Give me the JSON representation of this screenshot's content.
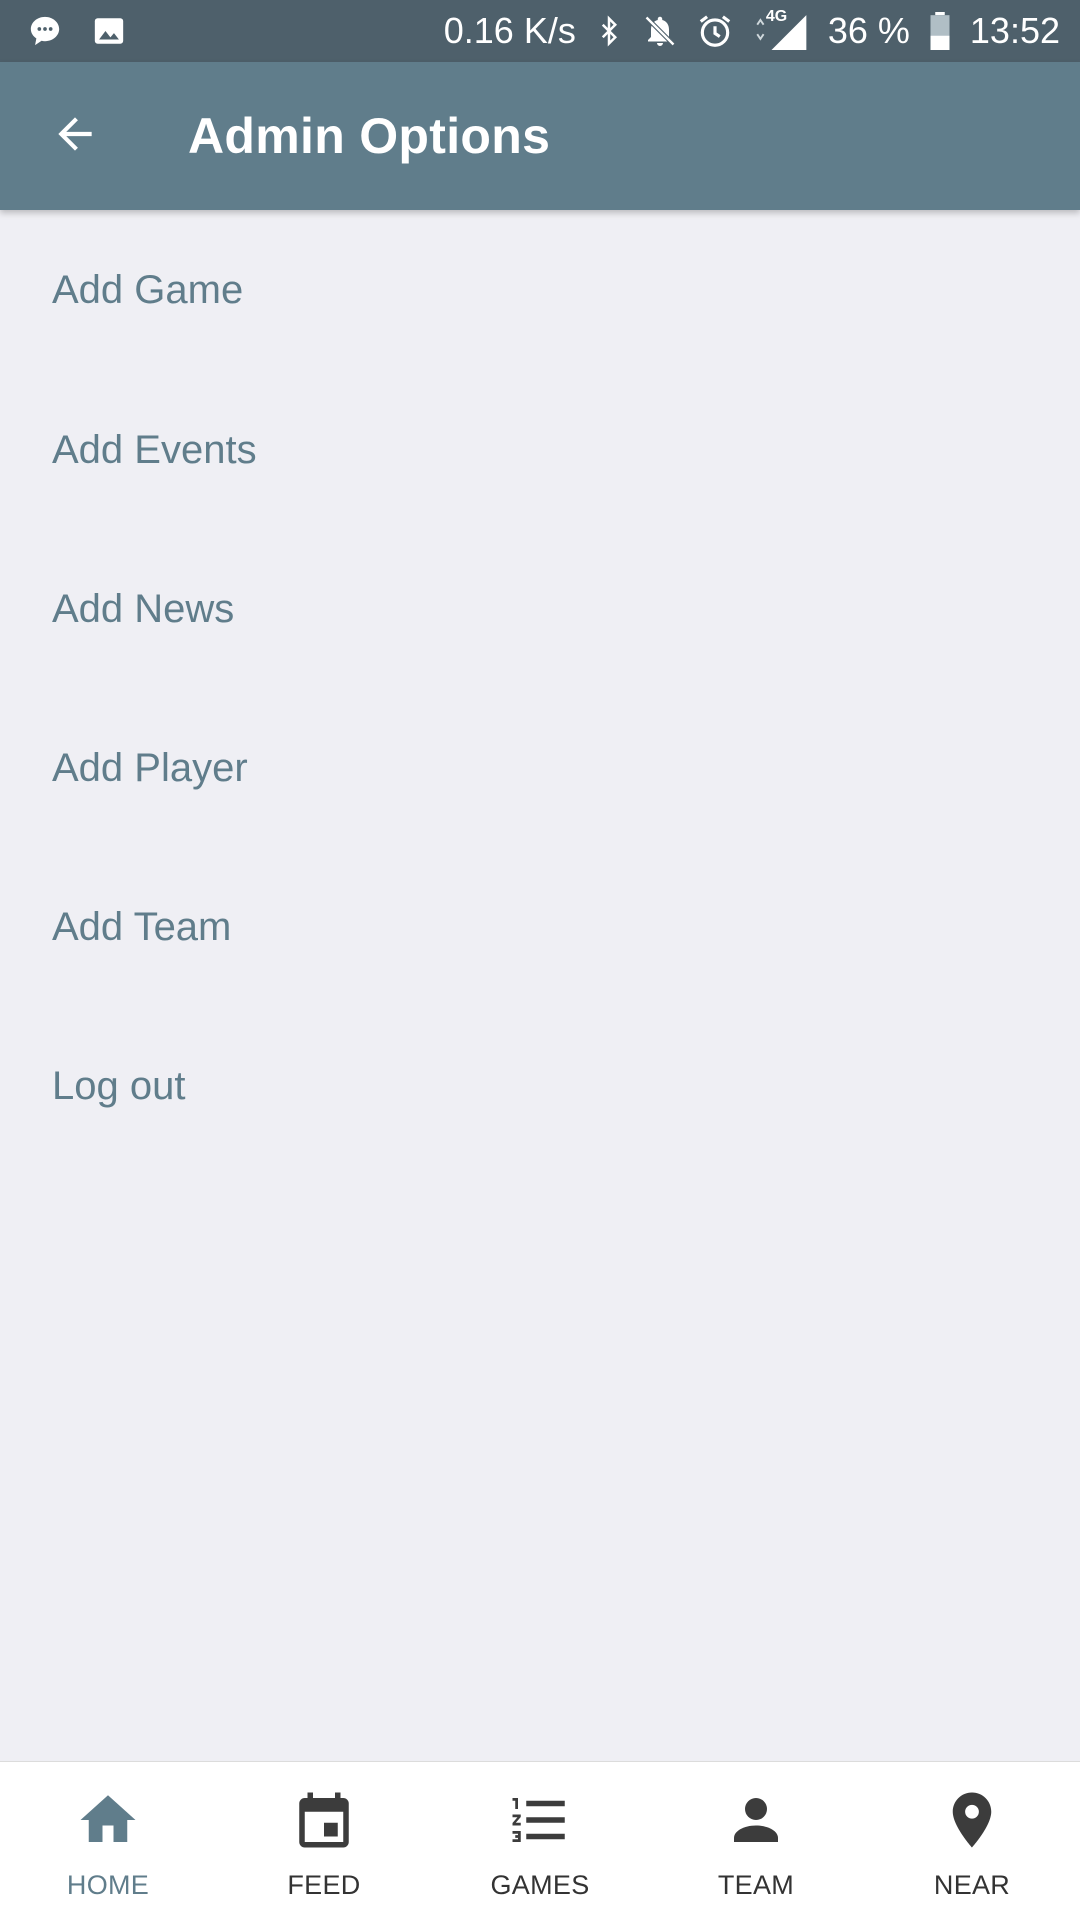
{
  "status_bar": {
    "network_speed": "0.16 K/s",
    "network_type": "4G",
    "battery": "36 %",
    "time": "13:52",
    "icons": [
      "chat-bubble-icon",
      "image-icon",
      "bluetooth-icon",
      "bell-off-icon",
      "alarm-icon",
      "signal-icon",
      "battery-icon"
    ]
  },
  "app_bar": {
    "title": "Admin Options",
    "back_icon": "arrow-back-icon"
  },
  "menu": {
    "items": [
      {
        "label": "Add Game"
      },
      {
        "label": "Add Events"
      },
      {
        "label": "Add News"
      },
      {
        "label": "Add Player"
      },
      {
        "label": "Add Team"
      },
      {
        "label": "Log out"
      }
    ]
  },
  "bottom_nav": {
    "items": [
      {
        "label": "HOME",
        "icon": "home-icon",
        "active": true
      },
      {
        "label": "FEED",
        "icon": "calendar-icon",
        "active": false
      },
      {
        "label": "GAMES",
        "icon": "numbered-list-icon",
        "active": false
      },
      {
        "label": "TEAM",
        "icon": "person-icon",
        "active": false
      },
      {
        "label": "NEAR",
        "icon": "location-pin-icon",
        "active": false
      }
    ]
  },
  "colors": {
    "status_bar": "#4e606b",
    "app_bar": "#607d8b",
    "background": "#efeff4",
    "menu_text": "#607d8b",
    "nav_active": "#607d8b",
    "nav_inactive": "#333333"
  }
}
